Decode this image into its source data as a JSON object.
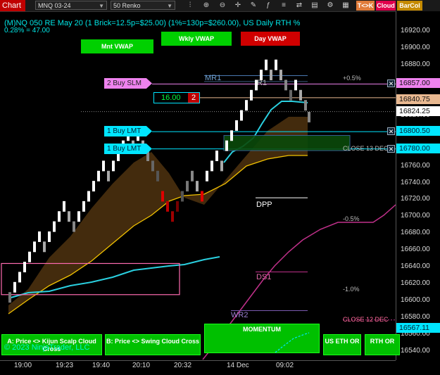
{
  "toolbar": {
    "chart_label": "Chart",
    "instrument": "MNQ 03-24",
    "bar_type": "50 Renko",
    "tk_label": "T<>K",
    "cloud_label": "Cloud",
    "barcol_label": "BarCol",
    "colors": {
      "chart_bg": "#c00000",
      "tk": "#e07b39",
      "cloud": "#e0004d",
      "barcol": "#c58a00"
    }
  },
  "header": {
    "line1": "(M)NQ 050 RE May 20 (1 Brick=12.5p=$25.00) (1%=130p=$260.00), US Daily RTH %",
    "line2": "0.28% = 47.00"
  },
  "vwap_buttons": [
    {
      "label": "Mnt VWAP",
      "color": "#00d000"
    },
    {
      "label": "Wkly VWAP",
      "color": "#00d000"
    },
    {
      "label": "Day VWAP",
      "color": "#d00000"
    }
  ],
  "orders": [
    {
      "label": "2 Buy SLM",
      "price": "16857.00",
      "color": "#ee82ee"
    },
    {
      "label": "1 Buy LMT",
      "price": "16800.50",
      "color": "#00e5ff"
    },
    {
      "label": "1 Buy LMT",
      "price": "16780.00",
      "color": "#00e5ff"
    }
  ],
  "position": {
    "pnl": "16.00",
    "qty": "2"
  },
  "levels": {
    "mr1": "MR1",
    "r1": "R1",
    "pct_up": "+0.5%",
    "close13": "CLOSE 13 DEC",
    "dpp": "DPP",
    "pct_dn": "-0.5%",
    "ds1": "DS1",
    "pct_dn1": "-1.0%",
    "wr2": "WR2",
    "close12": "CLOSE 12 DEC"
  },
  "price_axis": {
    "ticks": [
      "16920.00",
      "16900.00",
      "16880.00",
      "16860.00",
      "16840.00",
      "16820.00",
      "16800.00",
      "16780.00",
      "16760.00",
      "16740.00",
      "16720.00",
      "16700.00",
      "16680.00",
      "16660.00",
      "16640.00",
      "16620.00",
      "16600.00",
      "16580.00",
      "16560.00",
      "16540.00"
    ],
    "current_price": "16840.75",
    "crosshair_price": "16824.25",
    "low_price": "16567.11"
  },
  "time_axis": [
    "19:00",
    "19:23",
    "19:40",
    "20:10",
    "20:32",
    "14 Dec",
    "09:02"
  ],
  "bottom_buttons": {
    "kijun": "A: Price <> Kijun Scalp Cloud Cross",
    "swing": "B: Price <> Swing Cloud Cross",
    "momentum": "MOMENTUM",
    "us_eth": "US ETH OR",
    "rth": "RTH OR"
  },
  "copyright": "© 2023 NinjaTrader, LLC"
}
